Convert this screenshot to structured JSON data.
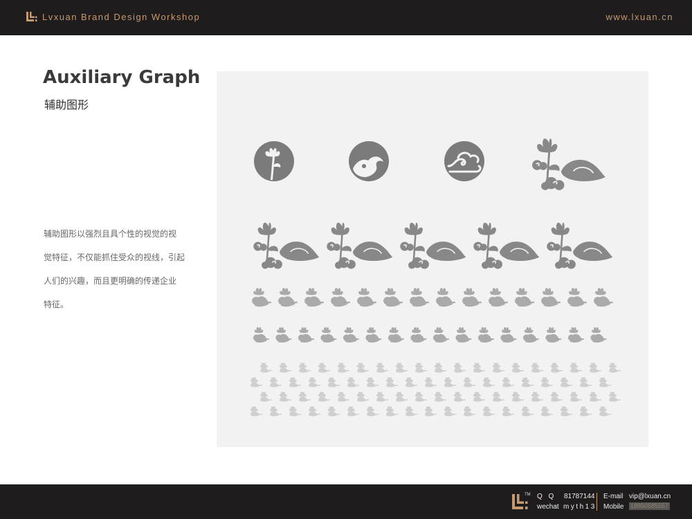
{
  "header": {
    "brand": "Lvxuan Brand Design Workshop",
    "url": "www.lxuan.cn",
    "logo_icon": "lx-logo-icon",
    "accent_color": "#c79a70"
  },
  "section": {
    "title_en": "Auxiliary Graph",
    "title_cn": "辅助图形",
    "description_lines": [
      "辅助图形以强烈且具个性的视觉的视",
      "觉特征，不仅能抓住受众的视线，引起",
      "人们的兴趣，而且更明确的传递企业",
      "特征。"
    ]
  },
  "graphics": {
    "icons": [
      "lotus-circle-icon",
      "wave-circle-icon",
      "cloud-circle-icon",
      "lotus-cloud-motif-icon"
    ],
    "pattern_rows": 5,
    "fill_color": "#888888",
    "panel_color": "#f2f2f2"
  },
  "footer": {
    "qq_label": "Q  Q",
    "qq_value": "81787144",
    "wechat_label": "wechat",
    "wechat_value": "myth13",
    "email_label": "E-mail",
    "email_value": "vip@lxuan.cn",
    "mobile_label": "Mobile",
    "mobile_value": "18850585557"
  }
}
